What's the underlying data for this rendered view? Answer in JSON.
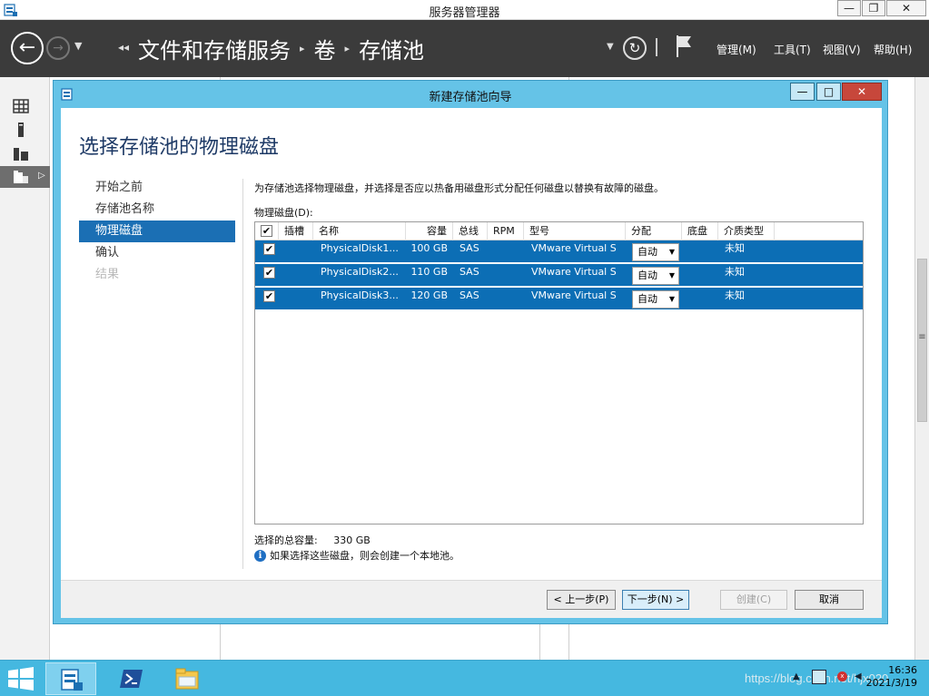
{
  "window": {
    "title": "服务器管理器",
    "min": "—",
    "max": "❐",
    "close": "✕"
  },
  "header": {
    "breadcrumb": [
      "文件和存储服务",
      "卷",
      "存储池"
    ],
    "menus": [
      "管理(M)",
      "工具(T)",
      "视图(V)",
      "帮助(H)"
    ],
    "icons": [
      "back-arrow-icon",
      "forward-arrow-icon",
      "refresh-icon",
      "flag-icon"
    ]
  },
  "rail": {
    "icons": [
      "dashboard-icon",
      "local-server-icon",
      "all-servers-icon",
      "file-storage-icon"
    ]
  },
  "dialog": {
    "title": "新建存储池向导",
    "min": "—",
    "max": "□",
    "close": "✕",
    "heading": "选择存储池的物理磁盘",
    "steps": [
      {
        "label": "开始之前",
        "state": "normal"
      },
      {
        "label": "存储池名称",
        "state": "normal"
      },
      {
        "label": "物理磁盘",
        "state": "active"
      },
      {
        "label": "确认",
        "state": "normal"
      },
      {
        "label": "结果",
        "state": "disabled"
      }
    ],
    "description": "为存储池选择物理磁盘，并选择是否应以热备用磁盘形式分配任何磁盘以替换有故障的磁盘。",
    "group_label": "物理磁盘(D):",
    "columns": [
      "插槽",
      "名称",
      "容量",
      "总线",
      "RPM",
      "型号",
      "分配",
      "底盘",
      "介质类型"
    ],
    "rows": [
      {
        "checked": "✔",
        "slot": "",
        "name": "PhysicalDisk1...",
        "capacity": "100 GB",
        "bus": "SAS",
        "rpm": "",
        "model": "VMware Virtual S",
        "allocation": "自动",
        "chassis": "",
        "media": "未知"
      },
      {
        "checked": "✔",
        "slot": "",
        "name": "PhysicalDisk2...",
        "capacity": "110 GB",
        "bus": "SAS",
        "rpm": "",
        "model": "VMware Virtual S",
        "allocation": "自动",
        "chassis": "",
        "media": "未知"
      },
      {
        "checked": "✔",
        "slot": "",
        "name": "PhysicalDisk3...",
        "capacity": "120 GB",
        "bus": "SAS",
        "rpm": "",
        "model": "VMware Virtual S",
        "allocation": "自动",
        "chassis": "",
        "media": "未知"
      }
    ],
    "header_check": "✔",
    "total_label": "选择的总容量:",
    "total_value": "330 GB",
    "info_icon": "i",
    "note": "如果选择这些磁盘，则会创建一个本地池。",
    "buttons": {
      "prev": "< 上一步(P)",
      "next": "下一步(N) >",
      "create": "创建(C)",
      "cancel": "取消"
    }
  },
  "taskbar": {
    "clock_time": "16:36",
    "clock_date": "2021/3/19",
    "watermark": "https://blog.csdn.net/hjx020",
    "tray_badge": "x"
  },
  "colors": {
    "header_bg": "#3b3b3b",
    "dialog_frame": "#65c3e7",
    "selection": "#0c6eb5",
    "heading": "#1e3a66",
    "taskbar": "#45b8e0"
  }
}
